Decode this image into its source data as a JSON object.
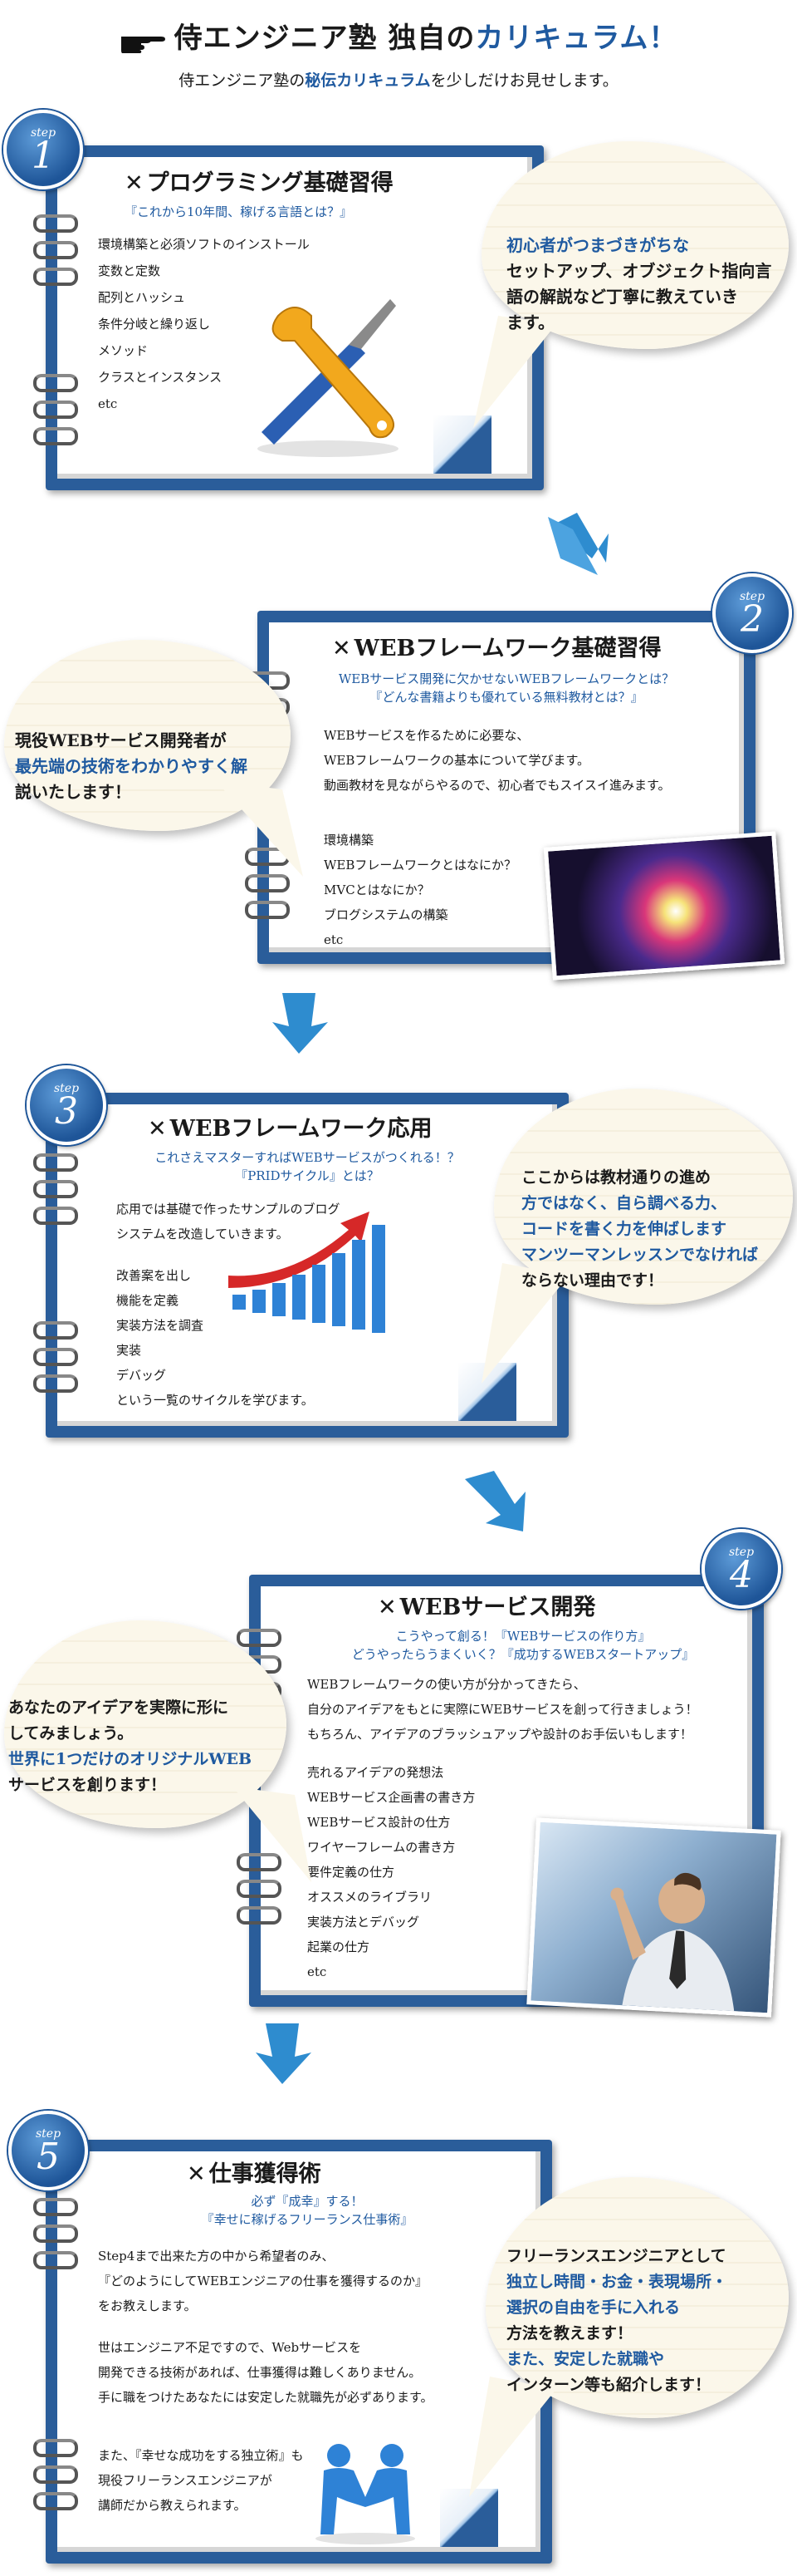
{
  "header": {
    "title_main": "侍エンジニア塾 独自の",
    "title_accent": "カリキュラム！",
    "subtitle_pre": "侍エンジニア塾の",
    "subtitle_accent": "秘伝カリキュラム",
    "subtitle_post": "を少しだけお見せします。"
  },
  "steps": [
    {
      "badge_word": "step",
      "badge_num": "1",
      "title": "プログラミング基礎習得",
      "lead": [
        "『これから10年間、稼げる言語とは？』"
      ],
      "items": [
        "環境構築と必須ソフトのインストール",
        "変数と定数",
        "配列とハッシュ",
        "条件分岐と繰り返し",
        "メソッド",
        "クラスとインスタンス",
        "etc"
      ],
      "bubble": [
        "初心者がつまづきがちな",
        "セットアップ、オブジェクト指向言",
        "語の解説など丁寧に教えていき",
        "ます。"
      ],
      "image": "tools-illustration"
    },
    {
      "badge_word": "step",
      "badge_num": "2",
      "title": "WEBフレームワーク基礎習得",
      "lead": [
        "WEBサービス開発に欠かせないWEBフレームワークとは？",
        "『どんな書籍よりも優れている無料教材とは？』"
      ],
      "para": [
        "WEBサービスを作るために必要な、",
        "WEBフレームワークの基本について学びます。",
        "動画教材を見ながらやるので、初心者でもスイスイ進みます。"
      ],
      "items": [
        "環境構築",
        "WEBフレームワークとはなにか？",
        "MVCとはなにか？",
        "ブログシステムの構築",
        "etc"
      ],
      "bubble": [
        "現役WEBサービス開発者が",
        "最先端の技術をわかりやすく解",
        "説いたします！"
      ],
      "image": "tech-light-image"
    },
    {
      "badge_word": "step",
      "badge_num": "3",
      "title": "WEBフレームワーク応用",
      "lead": [
        "これさえマスターすればWEBサービスがつくれる！？",
        "『PRIDサイクル』とは？"
      ],
      "para": [
        "応用では基礎で作ったサンプルのブログ",
        "システムを改造していきます。"
      ],
      "items": [
        "改善案を出し",
        "機能を定義",
        "実装方法を調査",
        "実装",
        "デバッグ",
        "という一覧のサイクルを学びます。"
      ],
      "bubble": [
        "ここからは教材通りの進め",
        "方ではなく、自ら調べる力、",
        "コードを書く力を伸ばします",
        "マンツーマンレッスンでなければ",
        "ならない理由です！"
      ],
      "image": "growth-chart"
    },
    {
      "badge_word": "step",
      "badge_num": "4",
      "title": "WEBサービス開発",
      "lead": [
        "こうやって創る！『WEBサービスの作り方』",
        "どうやったらうまくいく？『成功するWEBスタートアップ』"
      ],
      "para": [
        "WEBフレームワークの使い方が分かってきたら、",
        "自分のアイデアをもとに実際にWEBサービスを創って行きましょう！",
        "もちろん、アイデアのブラッシュアップや設計のお手伝いもします！"
      ],
      "items": [
        "売れるアイデアの発想法",
        "WEBサービス企画書の書き方",
        "WEBサービス設計の仕方",
        "ワイヤーフレームの書き方",
        "要件定義の仕方",
        "オススメのライブラリ",
        "実装方法とデバッグ",
        "起業の仕方",
        "etc"
      ],
      "bubble": [
        "あなたのアイデアを実際に形に",
        "してみましょう。",
        "世界に1つだけのオリジナルWEB",
        "サービスを創ります！"
      ],
      "image": "business-man-touch"
    },
    {
      "badge_word": "step",
      "badge_num": "5",
      "title": "仕事獲得術",
      "lead": [
        "必ず『成幸』する！",
        "『幸せに稼げるフリーランス仕事術』"
      ],
      "para": [
        "Step4まで出来た方の中から希望者のみ、",
        "『どのようにしてWEBエンジニアの仕事を獲得するのか』",
        "をお教えします。"
      ],
      "para2": [
        "世はエンジニア不足ですので、Webサービスを",
        "開発できる技術があれば、仕事獲得は難しくありません。",
        "手に職をつけたあなたには安定した就職先が必ずあります。"
      ],
      "para3": [
        "また、『幸せな成功をする独立術』も",
        "現役フリーランスエンジニアが",
        "講師だから教えられます。"
      ],
      "bubble": [
        "フリーランスエンジニアとして",
        "独立し時間・お金・表現場所・",
        "選択の自由を手に入れる",
        "方法を教えます！",
        "また、安定した就職や",
        "インターン等も紹介します！"
      ],
      "image": "handshake-figures"
    }
  ],
  "colors": {
    "accent": "#1f5aa0",
    "notebook": "#2a5d9a",
    "arrow": "#2e8ccf"
  }
}
